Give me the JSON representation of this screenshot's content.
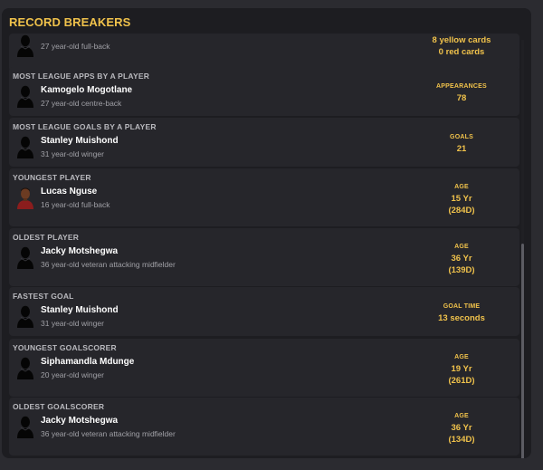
{
  "title": "RECORD BREAKERS",
  "cards": [
    {
      "label": "",
      "name": "",
      "desc": "27 year-old full-back",
      "stat_label": "",
      "stat_lines": [
        "8 yellow cards",
        "0 red cards"
      ],
      "avatar": "silhouette-icon"
    },
    {
      "label": "MOST LEAGUE APPS BY A PLAYER",
      "name": "Kamogelo Mogotlane",
      "desc": "27 year-old centre-back",
      "stat_label": "APPEARANCES",
      "stat_lines": [
        "78"
      ],
      "avatar": "silhouette-icon"
    },
    {
      "label": "MOST LEAGUE GOALS BY A PLAYER",
      "name": "Stanley Muishond",
      "desc": "31 year-old winger",
      "stat_label": "GOALS",
      "stat_lines": [
        "21"
      ],
      "avatar": "silhouette-icon"
    },
    {
      "label": "YOUNGEST PLAYER",
      "name": "Lucas Nguse",
      "desc": "16 year-old full-back",
      "stat_label": "AGE",
      "stat_lines": [
        "15 Yr",
        "(284D)"
      ],
      "avatar": "player-photo"
    },
    {
      "label": "OLDEST PLAYER",
      "name": "Jacky Motshegwa",
      "desc": "36 year-old veteran attacking midfielder",
      "stat_label": "AGE",
      "stat_lines": [
        "36 Yr",
        "(139D)"
      ],
      "avatar": "silhouette-icon"
    },
    {
      "label": "FASTEST GOAL",
      "name": "Stanley Muishond",
      "desc": "31 year-old winger",
      "stat_label": "GOAL TIME",
      "stat_lines": [
        "13 seconds"
      ],
      "avatar": "silhouette-icon"
    },
    {
      "label": "YOUNGEST GOALSCORER",
      "name": "Siphamandla Mdunge",
      "desc": "20 year-old winger",
      "stat_label": "AGE",
      "stat_lines": [
        "19 Yr",
        "(261D)"
      ],
      "avatar": "silhouette-icon"
    },
    {
      "label": "OLDEST GOALSCORER",
      "name": "Jacky Motshegwa",
      "desc": "36 year-old veteran attacking midfielder",
      "stat_label": "AGE",
      "stat_lines": [
        "36 Yr",
        "(134D)"
      ],
      "avatar": "silhouette-icon"
    }
  ]
}
